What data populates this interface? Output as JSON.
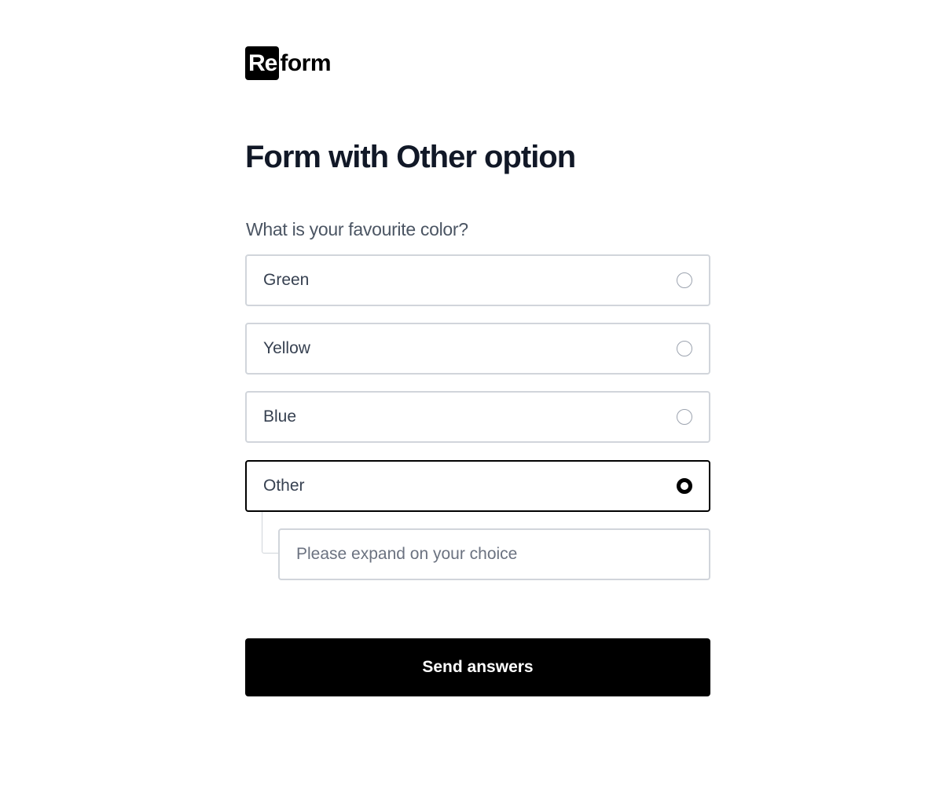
{
  "brand": {
    "logo_box_text": "Re",
    "logo_rest_text": "form"
  },
  "form": {
    "title": "Form with Other option",
    "question": "What is your favourite color?",
    "options": [
      {
        "label": "Green",
        "selected": false
      },
      {
        "label": "Yellow",
        "selected": false
      },
      {
        "label": "Blue",
        "selected": false
      },
      {
        "label": "Other",
        "selected": true
      }
    ],
    "other_input": {
      "value": "",
      "placeholder": "Please expand on your choice"
    },
    "submit_label": "Send answers"
  },
  "colors": {
    "primary": "#000000",
    "border": "#d1d5db",
    "title_text": "#111827",
    "label_text": "#374151",
    "question_text": "#4b5563"
  }
}
